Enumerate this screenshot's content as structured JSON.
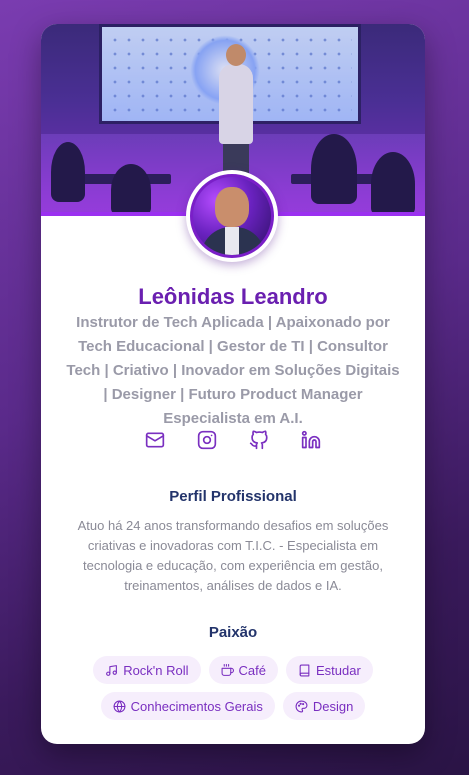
{
  "profile": {
    "name": "Leônidas Leandro",
    "bio": "Instrutor de Tech Aplicada | Apaixonado por Tech Educacional | Gestor de TI | Consultor Tech | Criativo | Inovador em Soluções Digitais | Designer | Futuro Product Manager Especialista em A.I."
  },
  "social_links": [
    {
      "icon": "mail-icon"
    },
    {
      "icon": "instagram-icon"
    },
    {
      "icon": "github-icon"
    },
    {
      "icon": "linkedin-icon"
    }
  ],
  "perfil": {
    "title": "Perfil Profissional",
    "text": "Atuo há 24 anos transformando desafios em soluções criativas e inovadoras com T.I.C. - Especialista em tecnologia e educação, com experiência em gestão, treinamentos, análises de dados e IA."
  },
  "paixao": {
    "title": "Paixão",
    "tags": [
      {
        "label": "Rock'n Roll",
        "icon": "music-note-icon"
      },
      {
        "label": "Café",
        "icon": "coffee-icon"
      },
      {
        "label": "Estudar",
        "icon": "book-icon"
      },
      {
        "label": "Conhecimentos Gerais",
        "icon": "globe-icon"
      },
      {
        "label": "Design",
        "icon": "palette-icon"
      }
    ]
  },
  "colors": {
    "accent": "#6a1fb0",
    "tag_bg": "#f6eefc",
    "tag_text": "#7a2fc0",
    "heading": "#23346b"
  }
}
